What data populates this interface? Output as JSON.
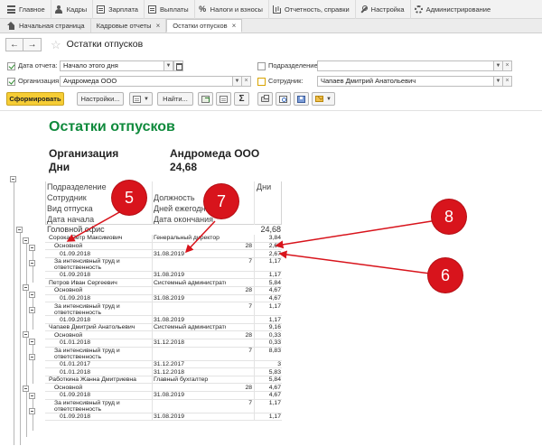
{
  "menu": [
    {
      "icon": "menu-lines-icon",
      "label": "Главное"
    },
    {
      "icon": "person-icon",
      "label": "Кадры"
    },
    {
      "icon": "document-icon",
      "label": "Зарплата"
    },
    {
      "icon": "document-icon",
      "label": "Выплаты"
    },
    {
      "icon": "percent-icon",
      "label": "Налоги и взносы"
    },
    {
      "icon": "chart-icon",
      "label": "Отчетность, справки"
    },
    {
      "icon": "wrench-icon",
      "label": "Настройка"
    },
    {
      "icon": "gear-icon",
      "label": "Администрирование"
    }
  ],
  "tabs": {
    "home": "Начальная страница",
    "reports": "Кадровые отчеты",
    "active": "Остатки отпусков"
  },
  "form": {
    "title": "Остатки отпусков"
  },
  "filters": {
    "date_label": "Дата отчета:",
    "date_value": "Начало этого дня",
    "org_label": "Организация:",
    "org_value": "Андромеда ООО",
    "dept_label": "Подразделение:",
    "dept_value": "",
    "emp_label": "Сотрудник:",
    "emp_value": "Чапаев Дмитрий Анатольевич"
  },
  "toolbar": {
    "generate": "Сформировать",
    "settings": "Настройки...",
    "find": "Найти..."
  },
  "report": {
    "title": "Остатки отпусков",
    "org_label": "Организация",
    "org_value": "Андромеда ООО",
    "days_label": "Дни",
    "days_value": "24,68",
    "headers": {
      "dept": "Подразделение",
      "employee": "Сотрудник",
      "vac_type": "Вид отпуска",
      "start": "Дата начала",
      "position": "Должность",
      "days_per_year": "Дней ежегодн...",
      "end": "Дата окончания",
      "days": "Дни"
    },
    "office": {
      "label": "Головной офис",
      "value": "24,68"
    },
    "rows": [
      {
        "level": 1,
        "name": "Сорока Петр Максимович",
        "pos": "Генеральный директор",
        "per_year": "",
        "days": "3,84"
      },
      {
        "level": 2,
        "name": "Основной",
        "pos": "",
        "per_year": "28",
        "days": "2,67"
      },
      {
        "level": 3,
        "name": "01.09.2018",
        "pos": "31.08.2019",
        "per_year": "",
        "days": "2,67"
      },
      {
        "level": 2,
        "name": "За интенсивный труд и ответственность",
        "pos": "",
        "per_year": "7",
        "days": "1,17",
        "tall": true
      },
      {
        "level": 3,
        "name": "01.09.2018",
        "pos": "31.08.2019",
        "per_year": "",
        "days": "1,17"
      },
      {
        "level": 1,
        "name": "Петров Иван Сергеевич",
        "pos": "Системный администратор",
        "per_year": "",
        "days": "5,84"
      },
      {
        "level": 2,
        "name": "Основной",
        "pos": "",
        "per_year": "28",
        "days": "4,67"
      },
      {
        "level": 3,
        "name": "01.09.2018",
        "pos": "31.08.2019",
        "per_year": "",
        "days": "4,67"
      },
      {
        "level": 2,
        "name": "За интенсивный труд и ответственность",
        "pos": "",
        "per_year": "7",
        "days": "1,17",
        "tall": true
      },
      {
        "level": 3,
        "name": "01.09.2018",
        "pos": "31.08.2019",
        "per_year": "",
        "days": "1,17"
      },
      {
        "level": 1,
        "name": "Чапаев Дмитрий Анатольевич",
        "pos": "Системный администратор",
        "per_year": "",
        "days": "9,16"
      },
      {
        "level": 2,
        "name": "Основной",
        "pos": "",
        "per_year": "28",
        "days": "0,33"
      },
      {
        "level": 3,
        "name": "01.01.2018",
        "pos": "31.12.2018",
        "per_year": "",
        "days": "0,33"
      },
      {
        "level": 2,
        "name": "За интенсивный труд и ответственность",
        "pos": "",
        "per_year": "7",
        "days": "8,83",
        "tall": true
      },
      {
        "level": 3,
        "name": "01.01.2017",
        "pos": "31.12.2017",
        "per_year": "",
        "days": "3"
      },
      {
        "level": 3,
        "name": "01.01.2018",
        "pos": "31.12.2018",
        "per_year": "",
        "days": "5,83"
      },
      {
        "level": 1,
        "name": "Работкина Жанна Дмитриевна",
        "pos": "Главный бухгалтер",
        "per_year": "",
        "days": "5,84"
      },
      {
        "level": 2,
        "name": "Основной",
        "pos": "",
        "per_year": "28",
        "days": "4,67"
      },
      {
        "level": 3,
        "name": "01.09.2018",
        "pos": "31.08.2019",
        "per_year": "",
        "days": "4,67"
      },
      {
        "level": 2,
        "name": "За интенсивный труд и ответственность",
        "pos": "",
        "per_year": "7",
        "days": "1,17",
        "tall": true
      },
      {
        "level": 3,
        "name": "01.09.2018",
        "pos": "31.08.2019",
        "per_year": "",
        "days": "1,17"
      }
    ]
  },
  "callouts": [
    "5",
    "7",
    "8",
    "6"
  ],
  "colors": {
    "title_green": "#0f8a3c",
    "callout_red": "#d8141c",
    "primary_button": "#f6cd35"
  }
}
